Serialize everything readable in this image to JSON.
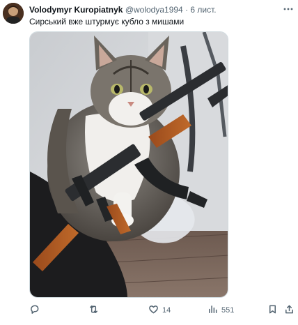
{
  "post": {
    "author_name": "Volodymyr Kuropiatnyk",
    "author_handle": "@wolodya1994",
    "separator": "·",
    "timestamp": "6 лист.",
    "text": "Сирський вже штурмує кубло з мишами"
  },
  "stats": {
    "likes": "14",
    "views": "551"
  },
  "icons": {
    "reply": "reply-icon",
    "repost": "repost-icon",
    "like": "heart-icon",
    "views": "views-icon",
    "bookmark": "bookmark-icon",
    "share": "share-icon",
    "more": "more-icon"
  },
  "colors": {
    "text_primary": "#0f1419",
    "text_secondary": "#536471",
    "border": "#cfd9de"
  }
}
